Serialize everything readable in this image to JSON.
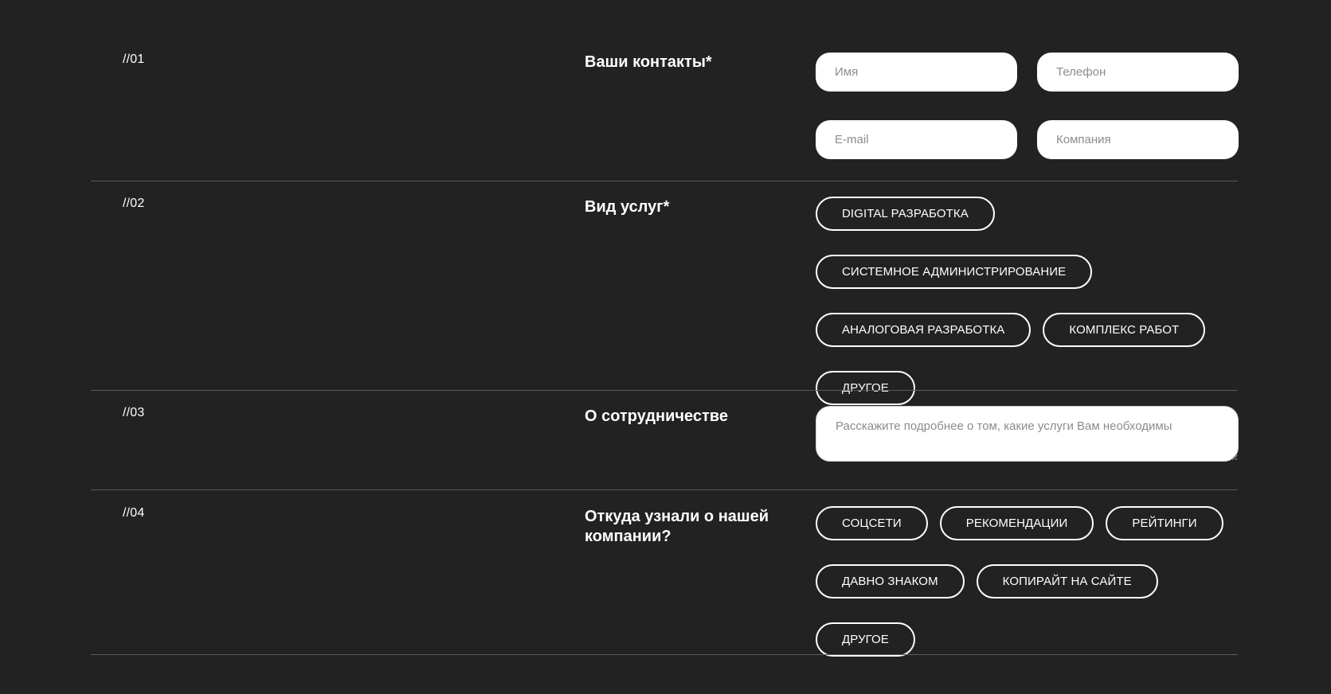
{
  "sections": [
    {
      "num": "//01",
      "title": "Ваши контакты*",
      "fields": [
        {
          "placeholder": "Имя"
        },
        {
          "placeholder": "Телефон"
        },
        {
          "placeholder": "E-mail"
        },
        {
          "placeholder": "Компания"
        }
      ]
    },
    {
      "num": "//02",
      "title": "Вид услуг*",
      "options": [
        "DIGITAL РАЗРАБОТКА",
        "СИСТЕМНОЕ АДМИНИСТРИРОВАНИЕ",
        "АНАЛОГОВАЯ РАЗРАБОТКА",
        "КОМПЛЕКС РАБОТ",
        "ДРУГОЕ"
      ]
    },
    {
      "num": "//03",
      "title": "О сотрудничестве",
      "textarea_placeholder": "Расскажите подробнее о том, какие услуги Вам необходимы"
    },
    {
      "num": "//04",
      "title": "Откуда узнали о нашей компании?",
      "options": [
        "СОЦСЕТИ",
        "РЕКОМЕНДАЦИИ",
        "РЕЙТИНГИ",
        "ДАВНО ЗНАКОМ",
        "КОПИРАЙТ НА САЙТЕ",
        "ДРУГОЕ"
      ]
    }
  ],
  "colors": {
    "background": "#222222",
    "text": "#ffffff",
    "divider": "#5a5a5a",
    "input_background": "#ffffff",
    "placeholder": "#8c8c8c"
  }
}
